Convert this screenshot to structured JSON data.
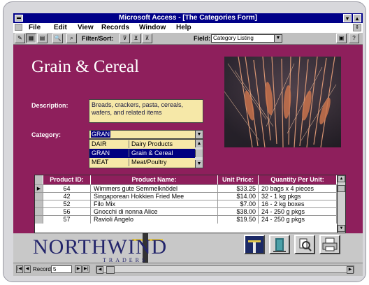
{
  "window": {
    "title": "Microsoft Access - [The Categories Form]",
    "minimize_glyph": "▾",
    "maximize_glyph": "▴"
  },
  "menubar": {
    "items": [
      "File",
      "Edit",
      "View",
      "Records",
      "Window",
      "Help"
    ]
  },
  "toolbar": {
    "filter_sort_label": "Filter/Sort:",
    "field_label": "Field:",
    "field_value": "Category Listing"
  },
  "form": {
    "title": "Grain & Cereal",
    "description_label": "Description:",
    "description_value": "Breads, crackers, pasta, cereals, wafers, and related items",
    "category_label": "Category:",
    "category_value": "GRAN",
    "category_options": [
      {
        "code": "DAIR",
        "name": "Dairy Products"
      },
      {
        "code": "GRAN",
        "name": "Grain & Cereal"
      },
      {
        "code": "MEAT",
        "name": "Meat/Poultry"
      }
    ],
    "selected_category_index": 1
  },
  "products": {
    "headers": [
      "Product ID:",
      "Product Name:",
      "Unit Price:",
      "Quantity Per Unit:"
    ],
    "rows": [
      {
        "id": "64",
        "name": "Wimmers gute Semmelknödel",
        "price": "$33.25",
        "qty": "20 bags x 4 pieces"
      },
      {
        "id": "42",
        "name": "Singaporean Hokkien Fried Mee",
        "price": "$14.00",
        "qty": "32 - 1 kg pkgs"
      },
      {
        "id": "52",
        "name": "Filo Mix",
        "price": "$7.00",
        "qty": "16 - 2 kg boxes"
      },
      {
        "id": "56",
        "name": "Gnocchi di nonna Alice",
        "price": "$38.00",
        "qty": "24 - 250 g pkgs"
      },
      {
        "id": "57",
        "name": "Ravioli Angelo",
        "price": "$19.50",
        "qty": "24 - 250 g pkgs"
      }
    ],
    "current_row_index": 0
  },
  "logo": {
    "name": "NORTHWIND",
    "sub": "TRADERS"
  },
  "record_nav": {
    "label": "Record:",
    "value": "5"
  },
  "colors": {
    "form_bg": "#8e1f5c",
    "field_bg": "#f6e8a8",
    "title_bar": "#000088"
  }
}
